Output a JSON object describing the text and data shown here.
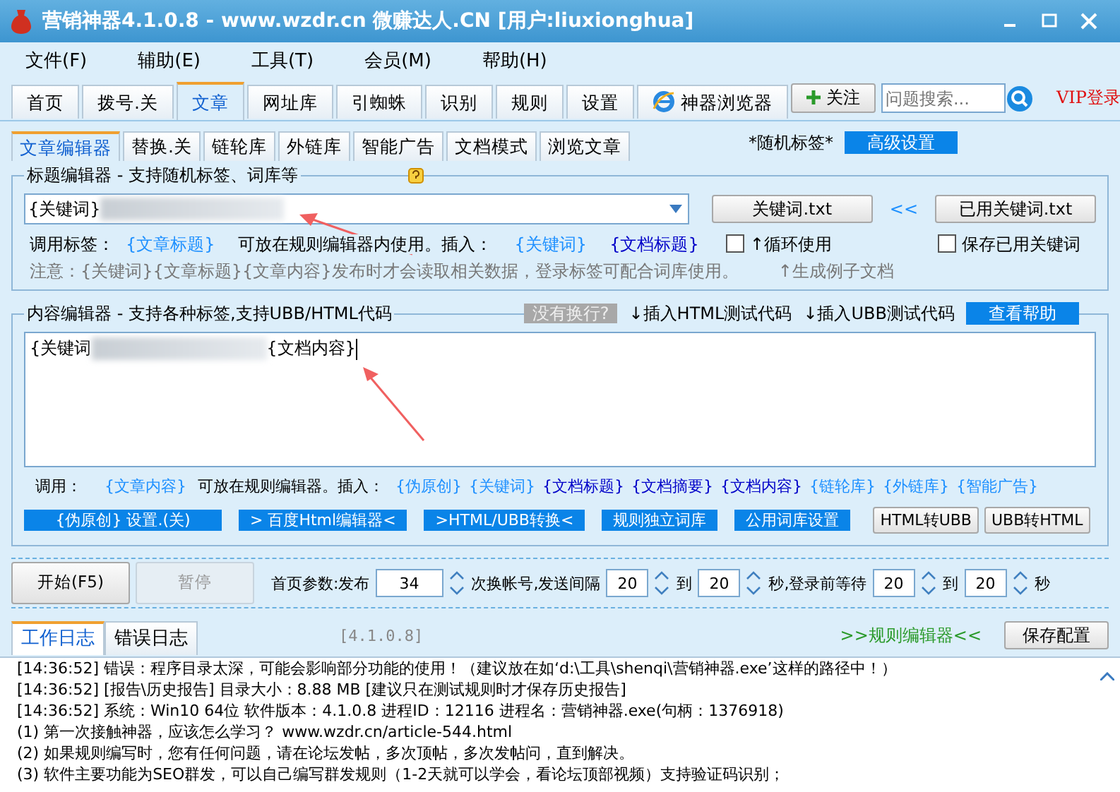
{
  "window": {
    "title": "营销神器4.1.0.8 - www.wzdr.cn 微赚达人.CN [用户:liuxionghua]"
  },
  "menu": [
    {
      "label": "文件(F)"
    },
    {
      "label": "辅助(E)"
    },
    {
      "label": "工具(T)"
    },
    {
      "label": "会员(M)"
    },
    {
      "label": "帮助(H)"
    }
  ],
  "main_tabs": [
    {
      "label": "首页",
      "selected": false,
      "kind": "text"
    },
    {
      "label": "拨号.关",
      "selected": false,
      "kind": "text"
    },
    {
      "label": "文章",
      "selected": true,
      "kind": "text"
    },
    {
      "label": "网址库",
      "selected": false,
      "kind": "text"
    },
    {
      "label": "引蜘蛛",
      "selected": false,
      "kind": "text"
    },
    {
      "label": "识别",
      "selected": false,
      "kind": "text"
    },
    {
      "label": "规则",
      "selected": false,
      "kind": "text"
    },
    {
      "label": "设置",
      "selected": false,
      "kind": "text"
    },
    {
      "label": "神器浏览器",
      "selected": false,
      "kind": "browser"
    }
  ],
  "follow_button": "关注",
  "search": {
    "placeholder": "问题搜索..."
  },
  "vip_link": "VIP登录",
  "sub_tabs": [
    {
      "label": "文章编辑器",
      "selected": true
    },
    {
      "label": "替换.关",
      "selected": false
    },
    {
      "label": "链轮库",
      "selected": false
    },
    {
      "label": "外链库",
      "selected": false
    },
    {
      "label": "智能广告",
      "selected": false
    },
    {
      "label": "文档模式",
      "selected": false
    },
    {
      "label": "浏览文章",
      "selected": false
    }
  ],
  "random_tag_label": "*随机标签*",
  "advanced_button": "高级设置",
  "title_editor": {
    "legend": "标题编辑器 - 支持随机标签、词库等",
    "value": "{关键词}",
    "keyword_button": "关键词.txt",
    "arrows": "<<",
    "used_button": "已用关键词.txt",
    "call_label": "调用标签：",
    "call_tag": "{文章标题}",
    "usage_note": "可放在规则编辑器内使用。插入：",
    "insert_tags": [
      "{关键词}",
      "{文档标题}"
    ],
    "loop": {
      "label": "↑循环使用",
      "checked": false
    },
    "save_used": {
      "label": "保存已用关键词",
      "checked": false
    },
    "notice": "注意：{关键词}{文章标题}{文章内容}发布时才会读取相关数据，登录标签可配合词库使用。",
    "generate": "↑生成例子文档"
  },
  "content_editor": {
    "legend": "内容编辑器 - 支持各种标签,支持UBB/HTML代码",
    "no_newline_button": "没有换行?",
    "insert_html": "↓插入HTML测试代码",
    "insert_ubb": "↓插入UBB测试代码",
    "help_button": "查看帮助",
    "content": [
      "{关键词",
      "{文档内容}"
    ],
    "call_label": "调用：",
    "call_tag": "{文章内容}",
    "usage_note": "可放在规则编辑器。插入：",
    "insert_tags": [
      {
        "label": "{伪原创}",
        "color": "#1e90ff"
      },
      {
        "label": "{关键词}",
        "color": "#1e90ff"
      },
      {
        "label": "{文档标题}",
        "color": "#0000c8"
      },
      {
        "label": "{文档摘要}",
        "color": "#0000c8"
      },
      {
        "label": "{文档内容}",
        "color": "#0000c8"
      },
      {
        "label": "{链轮库}",
        "color": "#1e90ff"
      },
      {
        "label": "{外链库}",
        "color": "#1e90ff"
      },
      {
        "label": "{智能广告}",
        "color": "#1e90ff"
      }
    ],
    "buttons": [
      {
        "label": "{伪原创} 设置.(关)",
        "kind": "flat"
      },
      {
        "label": "> 百度Html编辑器<",
        "kind": "flat"
      },
      {
        "label": ">HTML/UBB转换<",
        "kind": "flat"
      },
      {
        "label": "规则独立词库",
        "kind": "flat"
      },
      {
        "label": "公用词库设置",
        "kind": "flat"
      },
      {
        "label": "HTML转UBB",
        "kind": "raised"
      },
      {
        "label": "UBB转HTML",
        "kind": "raised"
      }
    ]
  },
  "run": {
    "start_button": "开始(F5)",
    "pause": {
      "label": "暂停",
      "disabled": true
    },
    "params": [
      {
        "kind": "label",
        "text": "首页参数:发布"
      },
      {
        "kind": "spin",
        "text": "34"
      },
      {
        "kind": "label",
        "text": "次换帐号,发送间隔"
      },
      {
        "kind": "spin",
        "text": "20"
      },
      {
        "kind": "label",
        "text": "到"
      },
      {
        "kind": "spin",
        "text": "20"
      },
      {
        "kind": "label",
        "text": "秒,登录前等待"
      },
      {
        "kind": "spin",
        "text": "20"
      },
      {
        "kind": "label",
        "text": "到"
      },
      {
        "kind": "spin",
        "text": "20"
      },
      {
        "kind": "label",
        "text": "秒"
      }
    ]
  },
  "log": {
    "tabs": [
      {
        "label": "工作日志",
        "selected": true
      },
      {
        "label": "错误日志",
        "selected": false
      }
    ],
    "version": "[4.1.0.8]",
    "rules_link": ">>规则编辑器<<",
    "save_button": "保存配置",
    "lines": [
      "[14:36:52] 错误：程序目录太深，可能会影响部分功能的使用！（建议放在如‘d:\\工具\\shenqi\\营销神器.exe’这样的路径中！）",
      "[14:36:52] [报告\\历史报告] 目录大小：8.88 MB [建议只在测试规则时才保存历史报告]",
      "[14:36:52] 系统：Win10 64位 软件版本：4.1.0.8 进程ID：12116 进程名：营销神器.exe(句柄：1376918)",
      "(1) 第一次接触神器，应该怎么学习？ www.wzdr.cn/article-544.html",
      "(2) 如果规则编写时，您有任何问题，请在论坛发帖，多次顶帖，多次发帖问，直到解决。",
      "(3) 软件主要功能为SEO群发，可以自己编写群发规则（1-2天就可以学会，看论坛顶部视频）支持验证码识别；"
    ]
  }
}
